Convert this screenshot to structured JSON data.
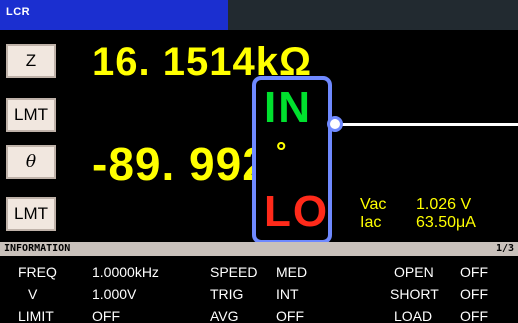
{
  "titlebar": {
    "title": "LCR"
  },
  "params": [
    {
      "name_label": "Z",
      "value": "16. 1514kΩ"
    },
    {
      "limit_label": "LMT"
    },
    {
      "name_label": "θ",
      "value": "-89. 992",
      "unit": "°"
    },
    {
      "limit_label": "LMT"
    }
  ],
  "judgment": {
    "upper": "IN",
    "lower": "LO",
    "upper_color": "#00e02e",
    "lower_color": "#ff2a1a"
  },
  "monitor": [
    {
      "label": "Vac",
      "value": "1.026 V"
    },
    {
      "label": "Iac",
      "value": "63.50μA"
    }
  ],
  "info": {
    "title": "INFORMATION",
    "page": "1/3",
    "rows": [
      [
        "FREQ",
        "1.0000kHz",
        "SPEED",
        "MED",
        "OPEN",
        "OFF"
      ],
      [
        "V",
        "1.000V",
        "TRIG",
        "INT",
        "SHORT",
        "OFF"
      ],
      [
        "LIMIT",
        "OFF",
        "AVG",
        "OFF",
        "LOAD",
        "OFF"
      ]
    ]
  },
  "colors": {
    "accent": "#1b2fd0",
    "value": "#ffff00",
    "highlight_border": "#6f89ff"
  }
}
